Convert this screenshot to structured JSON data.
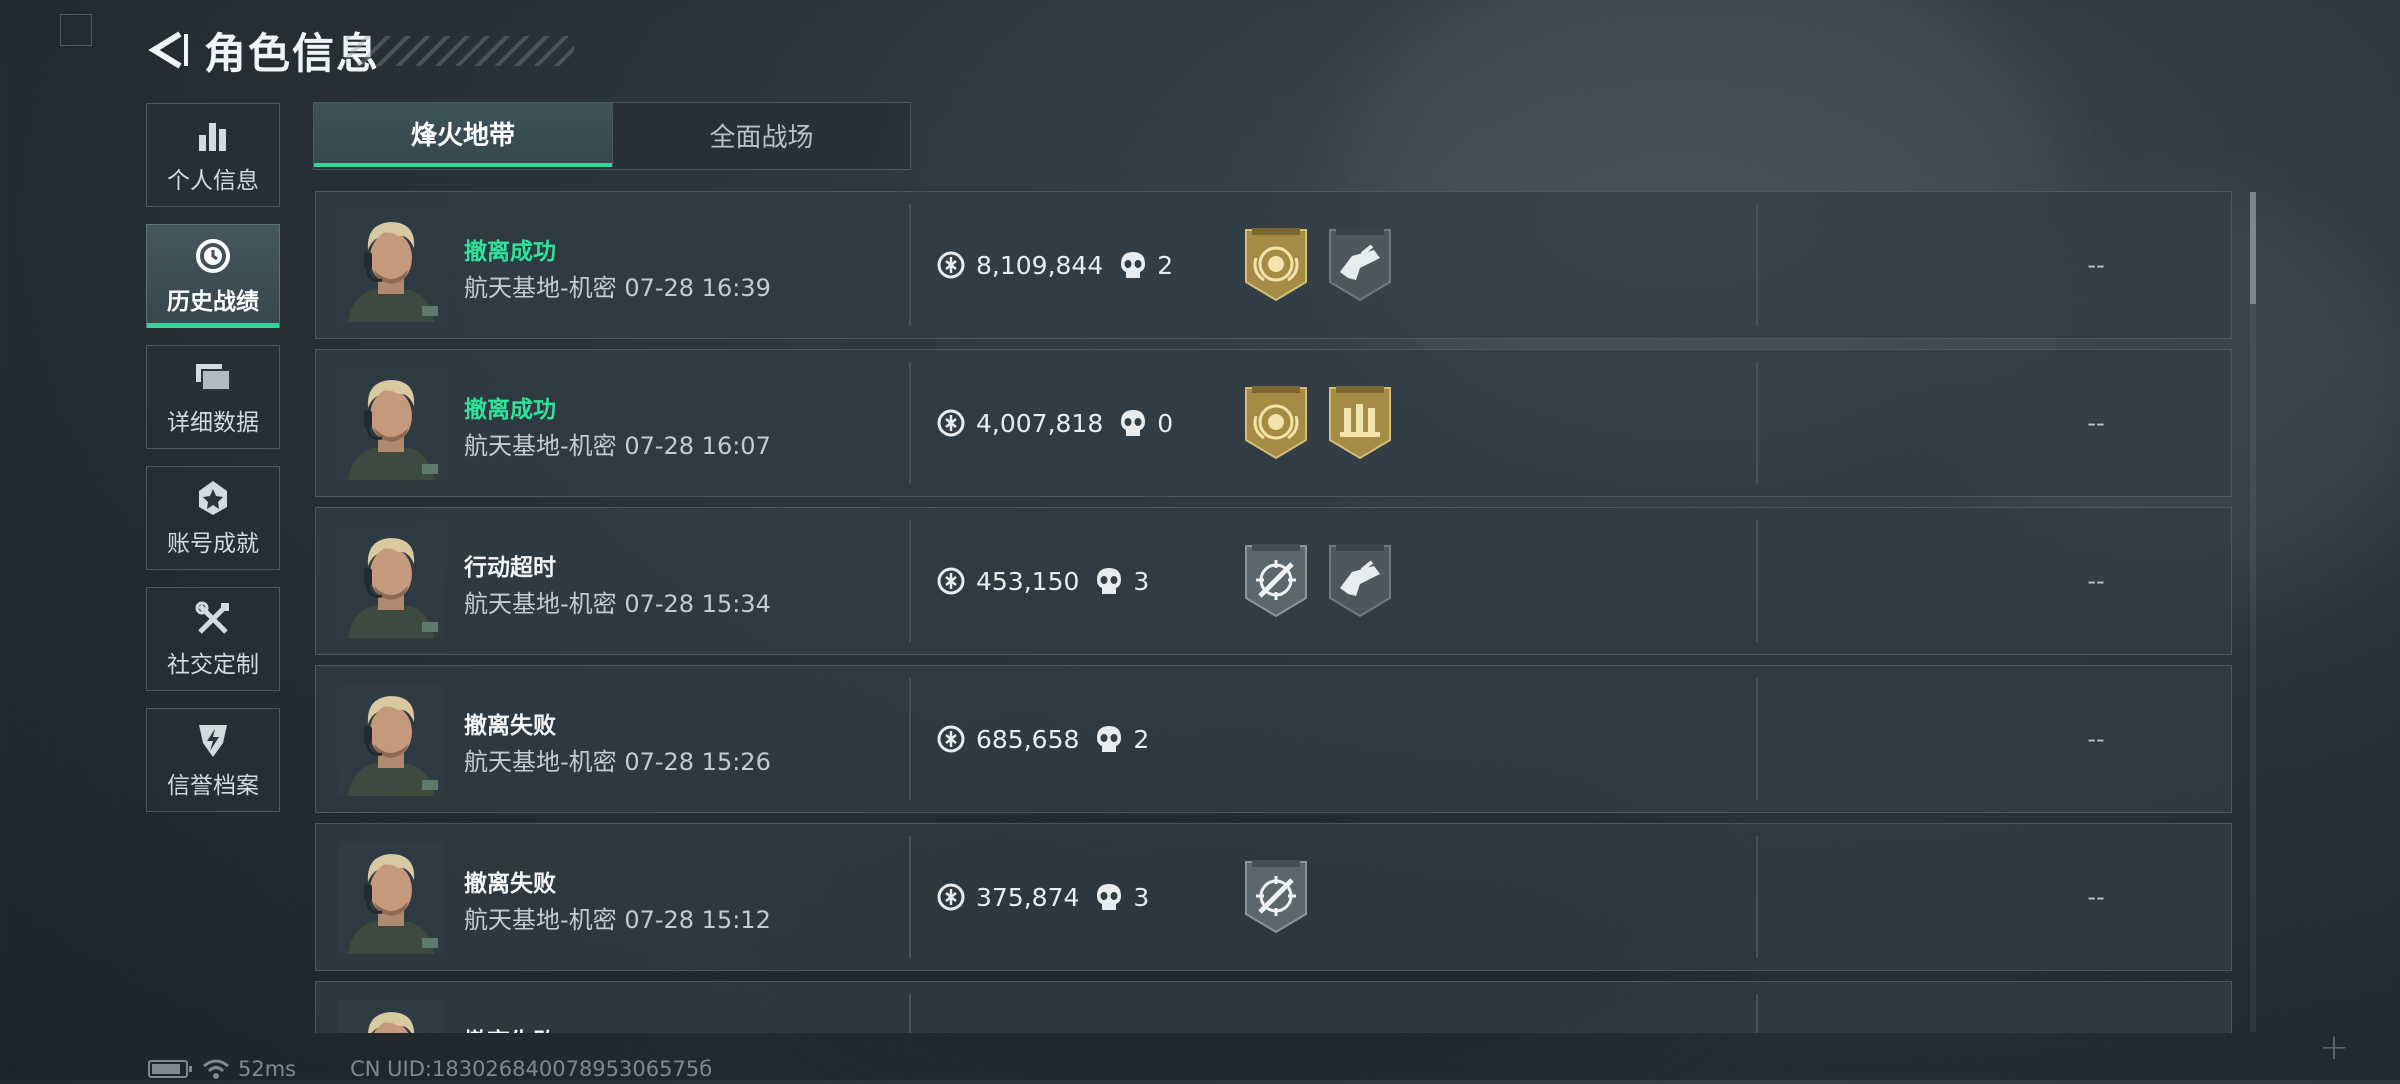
{
  "header": {
    "title": "角色信息"
  },
  "sidebar": {
    "items": [
      {
        "label": "个人信息",
        "icon": "bar-chart-icon"
      },
      {
        "label": "历史战绩",
        "icon": "history-clock-icon",
        "active": true
      },
      {
        "label": "详细数据",
        "icon": "folder-stack-icon"
      },
      {
        "label": "账号成就",
        "icon": "achievement-icon"
      },
      {
        "label": "社交定制",
        "icon": "tools-icon"
      },
      {
        "label": "信誉档案",
        "icon": "credit-shield-icon"
      }
    ]
  },
  "tabs": [
    {
      "label": "烽火地带",
      "active": true
    },
    {
      "label": "全面战场",
      "active": false
    }
  ],
  "records": [
    {
      "status": "撤离成功",
      "result": "success",
      "map": "航天基地-机密",
      "time": "07-28 16:39",
      "value": "8,109,844",
      "kills": "2",
      "badges": [
        "gold-emblem-badge-icon",
        "gray-weapon-badge-icon"
      ],
      "extra": "--"
    },
    {
      "status": "撤离成功",
      "result": "success",
      "map": "航天基地-机密",
      "time": "07-28 16:07",
      "value": "4,007,818",
      "kills": "0",
      "badges": [
        "gold-emblem-badge-icon",
        "gold-ammo-badge-icon"
      ],
      "extra": "--"
    },
    {
      "status": "行动超时",
      "result": "timeout",
      "map": "航天基地-机密",
      "time": "07-28 15:34",
      "value": "453,150",
      "kills": "3",
      "badges": [
        "gray-crosshair-badge-icon",
        "gray-weapon-badge-icon"
      ],
      "extra": "--"
    },
    {
      "status": "撤离失败",
      "result": "fail",
      "map": "航天基地-机密",
      "time": "07-28 15:26",
      "value": "685,658",
      "kills": "2",
      "badges": [],
      "extra": "--"
    },
    {
      "status": "撤离失败",
      "result": "fail",
      "map": "航天基地-机密",
      "time": "07-28 15:12",
      "value": "375,874",
      "kills": "3",
      "badges": [
        "gray-crosshair-badge-icon"
      ],
      "extra": "--"
    },
    {
      "status": "撤离失败",
      "result": "fail",
      "map": "",
      "time": "",
      "value": "",
      "kills": "",
      "badges": [],
      "extra": ""
    }
  ],
  "footer": {
    "ping": "52ms",
    "uid": "CN UID:18302684007895306575б"
  },
  "colors": {
    "accent": "#35d39a",
    "success": "#2fe39c",
    "gold_badge": "#b89a4e",
    "gray_badge": "#5d6a70"
  }
}
